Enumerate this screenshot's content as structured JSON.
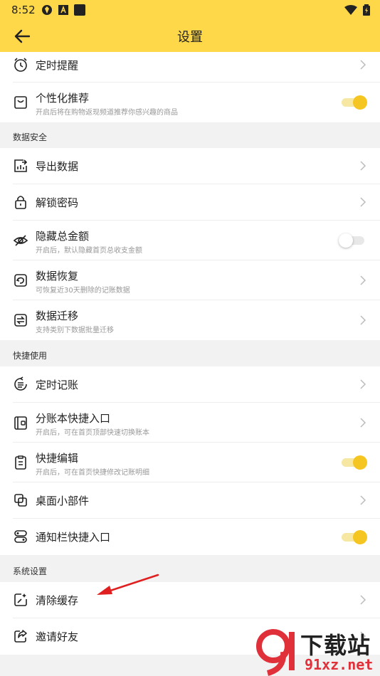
{
  "status": {
    "time": "8:52"
  },
  "header": {
    "title": "设置"
  },
  "rows_top": [
    {
      "label": "定时提醒",
      "icon": "clock-icon"
    },
    {
      "label": "个性化推荐",
      "sub": "开启后将在购物返现频道推荐你感兴趣的商品",
      "icon": "bag-icon",
      "toggle": true
    }
  ],
  "sections": {
    "data_security": "数据安全",
    "quick_use": "快捷使用",
    "system": "系统设置"
  },
  "data_security": [
    {
      "label": "导出数据",
      "icon": "export-icon"
    },
    {
      "label": "解锁密码",
      "icon": "lock-icon"
    },
    {
      "label": "隐藏总金额",
      "sub": "开启后，默认隐藏首页总收支金额",
      "icon": "eye-off-icon",
      "toggle": false
    },
    {
      "label": "数据恢复",
      "sub": "可恢复近30天删除的记账数据",
      "icon": "restore-icon"
    },
    {
      "label": "数据迁移",
      "sub": "支持类别下数据批量迁移",
      "icon": "migrate-icon"
    }
  ],
  "quick_use": [
    {
      "label": "定时记账",
      "icon": "schedule-icon"
    },
    {
      "label": "分账本快捷入口",
      "sub": "开启后，可在首页顶部快速切换账本",
      "icon": "ledger-icon"
    },
    {
      "label": "快捷编辑",
      "sub": "开启后，可在首页快捷修改记账明细",
      "icon": "edit-list-icon",
      "toggle": true
    },
    {
      "label": "桌面小部件",
      "icon": "widget-icon"
    },
    {
      "label": "通知栏快捷入口",
      "icon": "notification-icon",
      "toggle": true
    }
  ],
  "system": [
    {
      "label": "清除缓存",
      "icon": "clear-cache-icon"
    },
    {
      "label": "邀请好友",
      "icon": "share-icon"
    }
  ],
  "watermark": {
    "text1": "下载站",
    "text2": "91xz.net"
  },
  "colors": {
    "accent": "#ffd84a",
    "toggle_on": "#f5c522",
    "arrow": "#e02020"
  }
}
